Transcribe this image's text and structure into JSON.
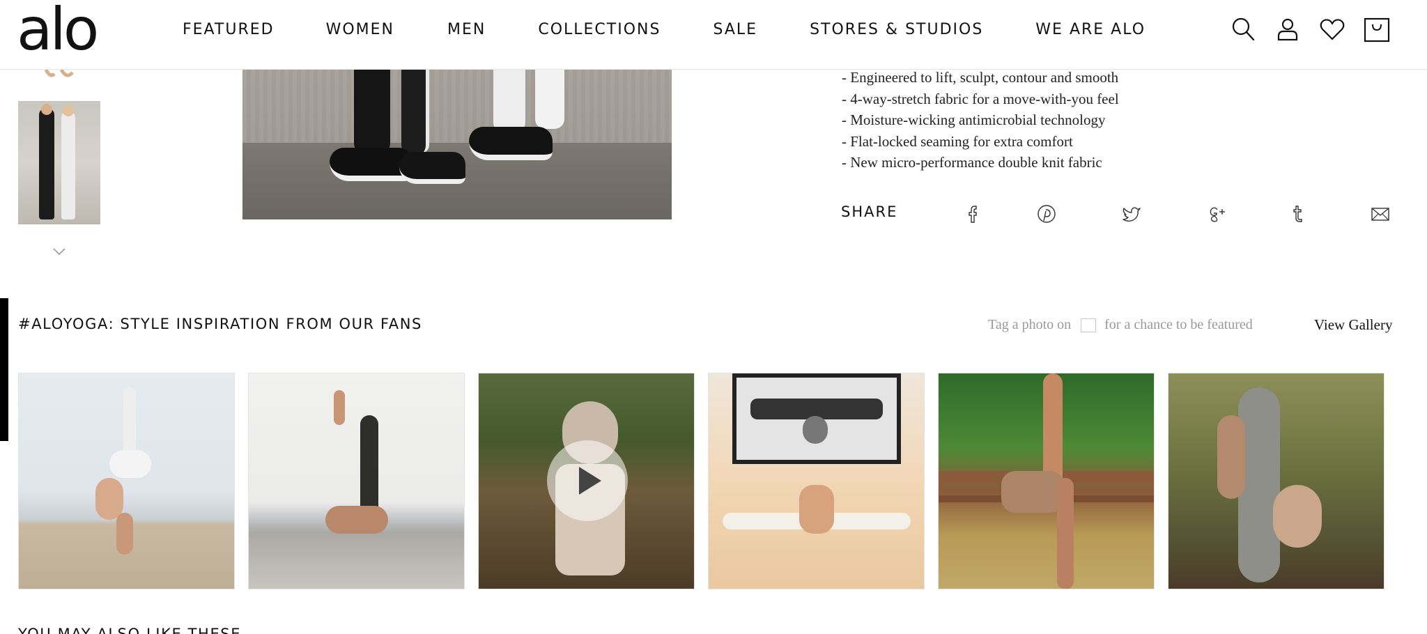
{
  "brand": {
    "logo_text": "alo"
  },
  "nav": {
    "items": [
      {
        "label": "FEATURED"
      },
      {
        "label": "WOMEN"
      },
      {
        "label": "MEN"
      },
      {
        "label": "COLLECTIONS"
      },
      {
        "label": "SALE"
      },
      {
        "label": "STORES & STUDIOS"
      },
      {
        "label": "WE ARE ALO"
      }
    ]
  },
  "header_icons": [
    "search-icon",
    "account-icon",
    "wishlist-heart-icon",
    "cart-bag-icon"
  ],
  "product": {
    "features": [
      "- Engineered to lift, sculpt, contour and smooth",
      "- 4-way-stretch fabric for a move-with-you feel",
      "- Moisture-wicking antimicrobial technology",
      "- Flat-locked seaming for extra comfort",
      "- New micro-performance double knit fabric"
    ],
    "share_label": "SHARE",
    "share_icons": [
      "facebook-icon",
      "pinterest-icon",
      "twitter-icon",
      "google-plus-icon",
      "tumblr-icon",
      "email-icon"
    ]
  },
  "inspiration": {
    "title": "#ALOYOGA: STYLE INSPIRATION FROM OUR FANS",
    "tag_prefix": "Tag a photo on",
    "tag_suffix": "for a chance to be featured",
    "view_gallery": "View Gallery",
    "images": [
      "fan-photo-1",
      "fan-photo-2",
      "fan-photo-3-video",
      "fan-photo-4",
      "fan-photo-5",
      "fan-photo-6"
    ]
  },
  "more": {
    "title": "YOU MAY ALSO LIKE THESE"
  },
  "colors": {
    "text": "#111111",
    "muted": "#9a9a9a",
    "divider": "#e6e6e6"
  }
}
